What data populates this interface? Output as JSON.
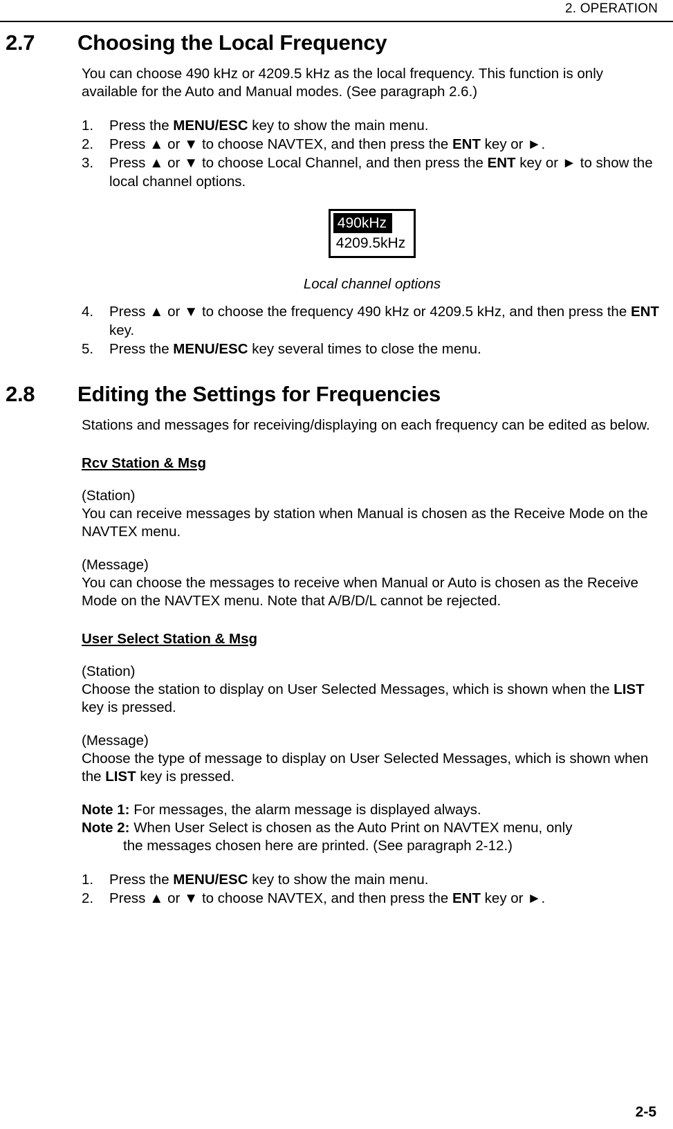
{
  "header": {
    "running_head": "2. OPERATION"
  },
  "sections": [
    {
      "number": "2.7",
      "title": "Choosing the Local Frequency",
      "intro": "You can choose 490 kHz or 4209.5 kHz as the local frequency. This function is only available for the Auto and Manual modes. (See paragraph 2.6.)",
      "steps_before": [
        {
          "idx": "1.",
          "html_key": "s27_step1"
        },
        {
          "idx": "2.",
          "html_key": "s27_step2"
        },
        {
          "idx": "3.",
          "html_key": "s27_step3"
        }
      ],
      "figure": {
        "selected_option": "490kHz",
        "other_option": "4209.5kHz",
        "caption": "Local channel options"
      },
      "steps_after": [
        {
          "idx": "4.",
          "html_key": "s27_step4"
        },
        {
          "idx": "5.",
          "html_key": "s27_step5"
        }
      ]
    },
    {
      "number": "2.8",
      "title": "Editing the Settings for Frequencies",
      "intro": "Stations and messages for receiving/displaying on each frequency can be edited as below.",
      "subheads": [
        {
          "label": "Rcv Station & Msg",
          "blocks": [
            {
              "title": "(Station)",
              "text": "You can receive messages by station when Manual is chosen as the Receive Mode on the NAVTEX menu."
            },
            {
              "title": "(Message)",
              "text": "You can choose the messages to receive when Manual or Auto is chosen as the Receive Mode on the NAVTEX menu. Note that A/B/D/L cannot be rejected."
            }
          ]
        },
        {
          "label": "User Select Station & Msg",
          "blocks": [
            {
              "title": "(Station)",
              "text": "Choose the station to display on User Selected Messages, which is shown when the LIST key is pressed."
            },
            {
              "title": "(Message)",
              "text": "Choose the type of message to display on User Selected Messages, which is shown when the LIST key is pressed."
            }
          ]
        }
      ],
      "notes": [
        {
          "label": "Note 1:",
          "text": "For messages, the alarm message is displayed always."
        },
        {
          "label": "Note 2:",
          "text": "When User Select is chosen as the Auto Print on NAVTEX menu, only the messages chosen here are printed. (See paragraph 2-12.)"
        }
      ],
      "steps": [
        {
          "idx": "1.",
          "html_key": "s28_step1"
        },
        {
          "idx": "2.",
          "html_key": "s28_step2"
        }
      ]
    }
  ],
  "text_fragments": {
    "s27_step1_a": "Press the ",
    "s27_step1_b": "MENU/ESC",
    "s27_step1_c": " key to show the main menu.",
    "s27_step2_a": "Press ▲ or ▼ to choose NAVTEX, and then press the ",
    "s27_step2_b": "ENT",
    "s27_step2_c": " key or ►.",
    "s27_step3_a": "Press ▲ or ▼ to choose Local Channel, and then press the ",
    "s27_step3_b": "ENT",
    "s27_step3_c": " key or ► to show the local channel options.",
    "s27_step4_a": "Press ▲ or ▼ to choose the frequency 490 kHz or 4209.5 kHz, and then press the ",
    "s27_step4_b": "ENT",
    "s27_step4_c": " key.",
    "s27_step5_a": "Press the ",
    "s27_step5_b": "MENU/ESC",
    "s27_step5_c": " key several times to close the menu.",
    "rcv_station_text_a": "You can receive messages by station when Manual is chosen as the Receive Mode on the NAVTEX menu.",
    "rcv_message_text_a": "You can choose the messages to receive when Manual or Auto is chosen as the Receive Mode on the NAVTEX menu. Note that A/B/D/L cannot be rejected.",
    "usr_station_text_a": "Choose the station to display on User Selected Messages, which is shown when the ",
    "usr_station_text_b": "LIST",
    "usr_station_text_c": " key is pressed.",
    "usr_message_text_a": "Choose the type of message to display on User Selected Messages, which is shown when the ",
    "usr_message_text_b": "LIST",
    "usr_message_text_c": " key is pressed.",
    "note1_text": "For messages, the alarm message is displayed always.",
    "note2_text_line1": "When User Select is chosen as the Auto Print on NAVTEX menu, only",
    "note2_text_line2": "the messages chosen here are printed. (See paragraph 2-12.)",
    "s28_step1_a": "Press the ",
    "s28_step1_b": "MENU/ESC",
    "s28_step1_c": " key to show the main menu.",
    "s28_step2_a": "Press ▲ or ▼ to choose NAVTEX, and then press the ",
    "s28_step2_b": "ENT",
    "s28_step2_c": " key or ►."
  },
  "footer": {
    "page_number": "2-5"
  }
}
